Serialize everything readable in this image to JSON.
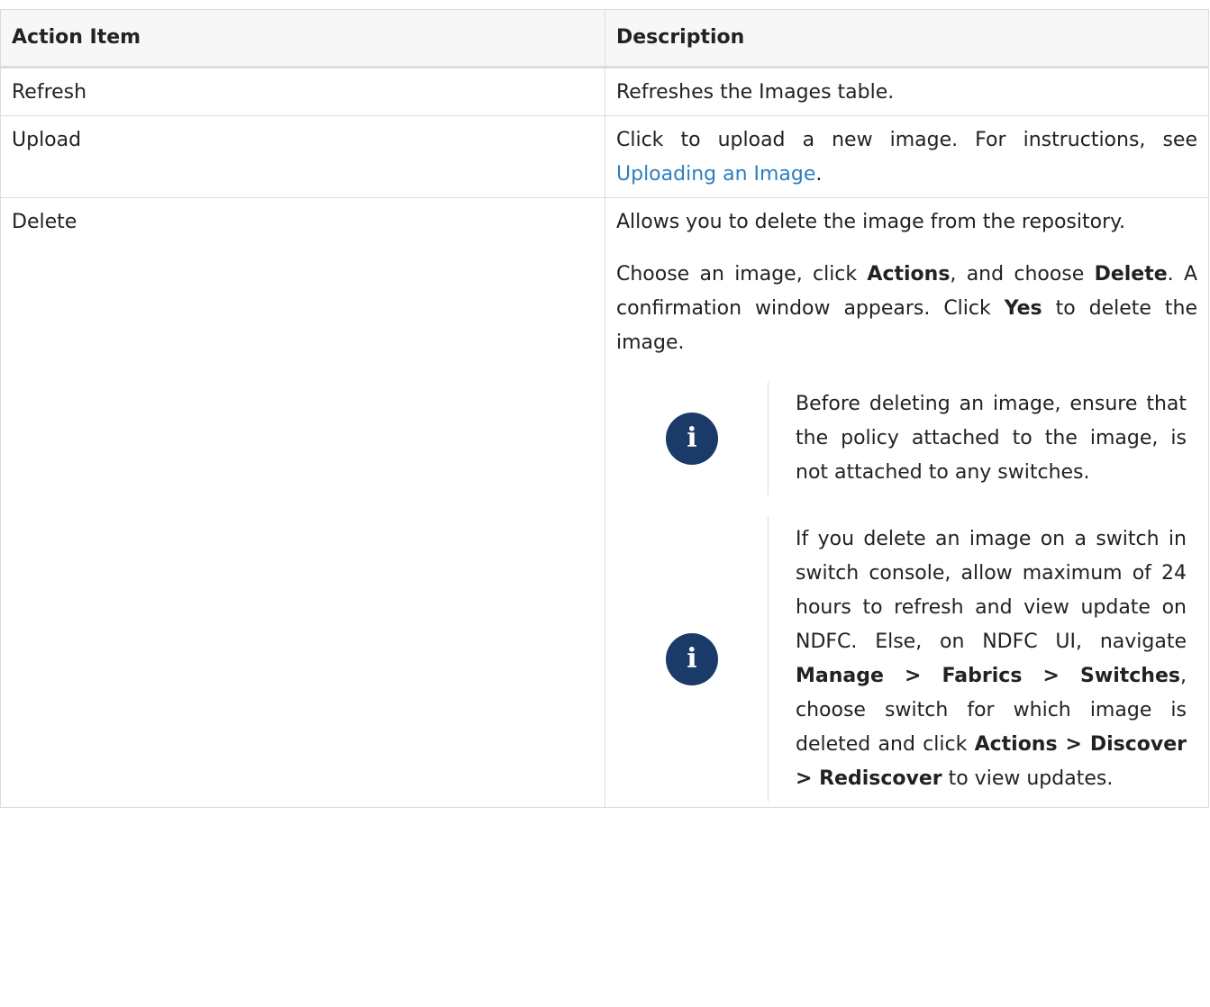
{
  "table": {
    "headers": {
      "action": "Action Item",
      "description": "Description"
    },
    "rows": [
      {
        "action": "Refresh",
        "description": "Refreshes the Images table."
      },
      {
        "action": "Upload",
        "description_prefix": "Click to upload a new image. For instructions, see ",
        "link": "Uploading an Image",
        "description_suffix": "."
      },
      {
        "action": "Delete",
        "para1": "Allows you to delete the image from the repository.",
        "para2": {
          "t1": "Choose an image, click ",
          "b1": "Actions",
          "t2": ", and choose ",
          "b2": "Delete",
          "t3": ". A confirmation window appears. Click ",
          "b3": "Yes",
          "t4": " to delete the image."
        },
        "note1": {
          "icon": "info-icon",
          "text": "Before deleting an image, ensure that the policy attached to the image, is not attached to any switches."
        },
        "note2": {
          "icon": "info-icon",
          "t1": "If you delete an image on a switch in switch console, allow maximum of 24 hours to refresh and view update on NDFC. Else, on NDFC UI, navigate ",
          "b1": "Manage > Fabrics > Switches",
          "t2": ", choose switch for which image is deleted and click ",
          "b2": "Actions > Discover > Rediscover",
          "t3": " to view updates."
        }
      }
    ]
  },
  "colors": {
    "link": "#2b7fc2",
    "icon_bg": "#1a3b6a",
    "border": "#dcdcdc",
    "header_bg": "#f7f7f7"
  }
}
